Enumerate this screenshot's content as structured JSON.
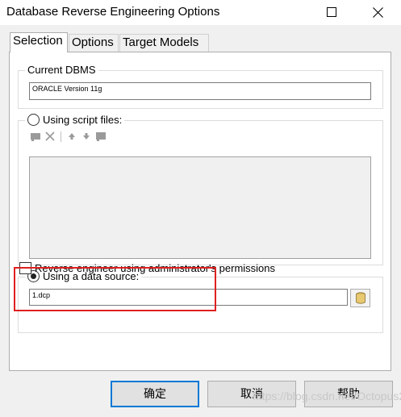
{
  "window": {
    "title": "Database Reverse Engineering Options"
  },
  "tabs": [
    {
      "label": "Selection",
      "active": true
    },
    {
      "label": "Options",
      "active": false
    },
    {
      "label": "Target Models",
      "active": false
    }
  ],
  "current_dbms": {
    "legend": "Current DBMS",
    "value": "ORACLE Version 11g"
  },
  "script_files": {
    "label": "Using script files:",
    "selected": false,
    "toolbar": [
      "add-icon",
      "delete-icon",
      "move-up-icon",
      "move-down-icon",
      "browse-icon"
    ]
  },
  "data_source": {
    "label": "Using a data source:",
    "selected": true,
    "value": "1.dcp",
    "connect_icon": "database-icon"
  },
  "admin_permissions": {
    "label": "Reverse engineer using administrator's permissions",
    "checked": false
  },
  "buttons": {
    "ok": "确定",
    "cancel": "取消",
    "help": "帮助"
  },
  "watermark": "https://blog.csdn.net/Octopus21",
  "colors": {
    "highlight": "#e02020",
    "default_button_border": "#0078d7"
  }
}
